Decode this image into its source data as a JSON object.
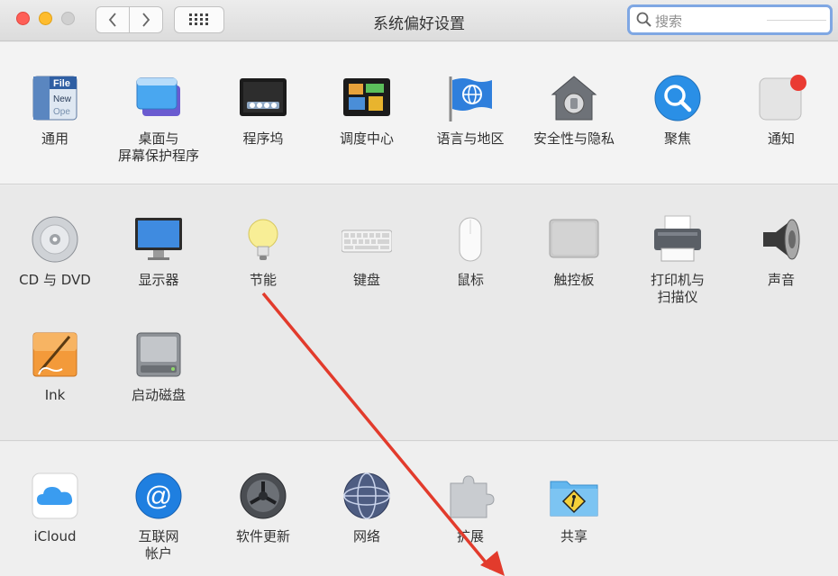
{
  "window": {
    "title": "系统偏好设置",
    "search_placeholder": "搜索"
  },
  "toolbar": {
    "back_glyph": "‹",
    "forward_glyph": "›"
  },
  "section1": [
    {
      "label": "通用",
      "icon": "general-icon"
    },
    {
      "label": "桌面与\n屏幕保护程序",
      "icon": "desktop-screensaver-icon"
    },
    {
      "label": "程序坞",
      "icon": "dock-icon"
    },
    {
      "label": "调度中心",
      "icon": "mission-control-icon"
    },
    {
      "label": "语言与地区",
      "icon": "language-region-icon"
    },
    {
      "label": "安全性与隐私",
      "icon": "security-privacy-icon"
    },
    {
      "label": "聚焦",
      "icon": "spotlight-icon"
    },
    {
      "label": "通知",
      "icon": "notifications-icon"
    }
  ],
  "section2": [
    {
      "label": "CD 与 DVD",
      "icon": "cd-dvd-icon"
    },
    {
      "label": "显示器",
      "icon": "displays-icon"
    },
    {
      "label": "节能",
      "icon": "energy-saver-icon"
    },
    {
      "label": "键盘",
      "icon": "keyboard-icon"
    },
    {
      "label": "鼠标",
      "icon": "mouse-icon"
    },
    {
      "label": "触控板",
      "icon": "trackpad-icon"
    },
    {
      "label": "打印机与\n扫描仪",
      "icon": "printers-scanners-icon"
    },
    {
      "label": "声音",
      "icon": "sound-icon"
    },
    {
      "label": "Ink",
      "icon": "ink-icon"
    },
    {
      "label": "启动磁盘",
      "icon": "startup-disk-icon"
    }
  ],
  "section3": [
    {
      "label": "iCloud",
      "icon": "icloud-icon"
    },
    {
      "label": "互联网\n帐户",
      "icon": "internet-accounts-icon"
    },
    {
      "label": "软件更新",
      "icon": "software-update-icon"
    },
    {
      "label": "网络",
      "icon": "network-icon"
    },
    {
      "label": "扩展",
      "icon": "extensions-icon"
    },
    {
      "label": "共享",
      "icon": "sharing-icon"
    }
  ],
  "colors": {
    "annotation_arrow": "#e23b2c",
    "search_focus": "#7fa7e3"
  }
}
